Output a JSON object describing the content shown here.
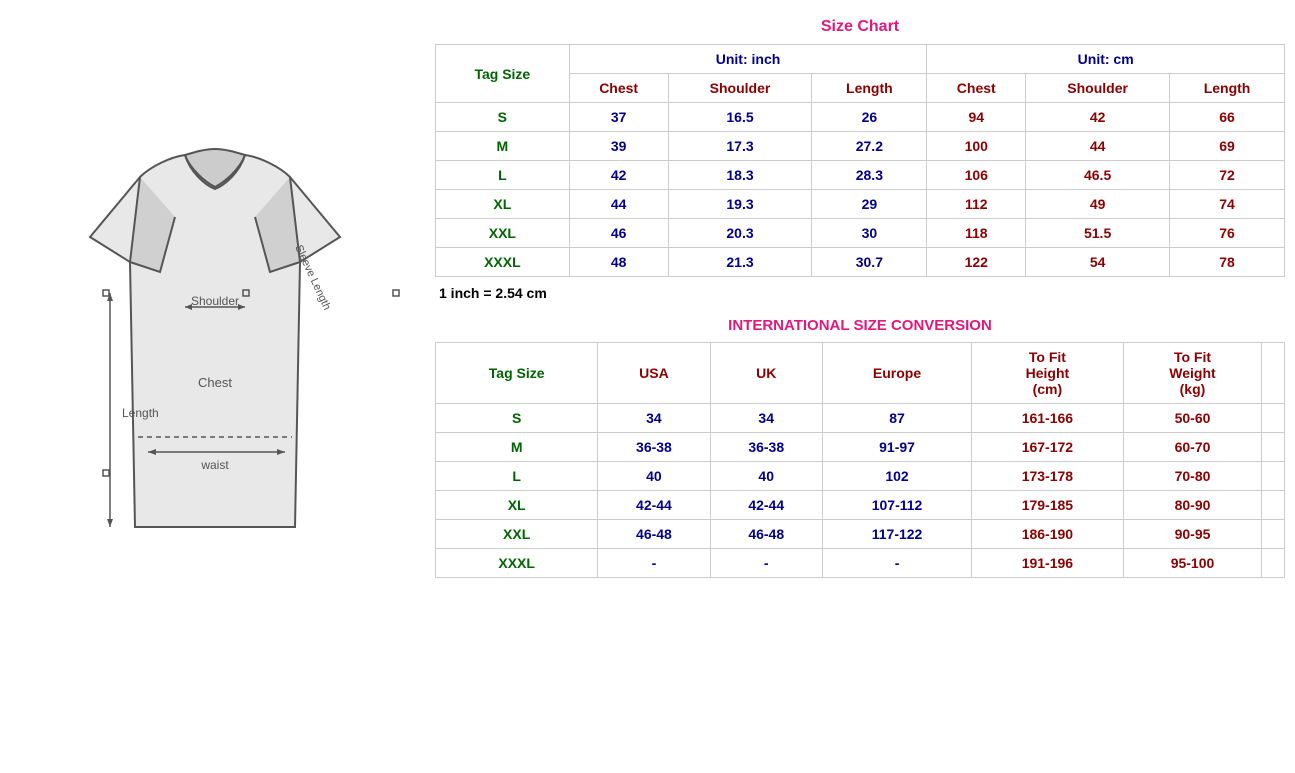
{
  "sizeChart": {
    "title": "Size Chart",
    "unitInch": "Unit: inch",
    "unitCm": "Unit: cm",
    "tagSizeLabel": "Tag Size",
    "headers": {
      "chest": "Chest",
      "shoulder": "Shoulder",
      "length": "Length"
    },
    "rows": [
      {
        "size": "S",
        "chestIn": "37",
        "shoulderIn": "16.5",
        "lengthIn": "26",
        "chestCm": "94",
        "shoulderCm": "42",
        "lengthCm": "66"
      },
      {
        "size": "M",
        "chestIn": "39",
        "shoulderIn": "17.3",
        "lengthIn": "27.2",
        "chestCm": "100",
        "shoulderCm": "44",
        "lengthCm": "69"
      },
      {
        "size": "L",
        "chestIn": "42",
        "shoulderIn": "18.3",
        "lengthIn": "28.3",
        "chestCm": "106",
        "shoulderCm": "46.5",
        "lengthCm": "72"
      },
      {
        "size": "XL",
        "chestIn": "44",
        "shoulderIn": "19.3",
        "lengthIn": "29",
        "chestCm": "112",
        "shoulderCm": "49",
        "lengthCm": "74"
      },
      {
        "size": "XXL",
        "chestIn": "46",
        "shoulderIn": "20.3",
        "lengthIn": "30",
        "chestCm": "118",
        "shoulderCm": "51.5",
        "lengthCm": "76"
      },
      {
        "size": "XXXL",
        "chestIn": "48",
        "shoulderIn": "21.3",
        "lengthIn": "30.7",
        "chestCm": "122",
        "shoulderCm": "54",
        "lengthCm": "78"
      }
    ],
    "conversionNote": "1 inch = 2.54 cm"
  },
  "intlConversion": {
    "title": "INTERNATIONAL SIZE CONVERSION",
    "tagSizeLabel": "Tag Size",
    "headers": {
      "usa": "USA",
      "uk": "UK",
      "europe": "Europe",
      "toFitHeight": "To Fit",
      "heightSub": "Height",
      "heightUnit": "(cm)",
      "toFitWeight": "To Fit",
      "weightSub": "Weight",
      "weightUnit": "(kg)"
    },
    "rows": [
      {
        "size": "S",
        "usa": "34",
        "uk": "34",
        "europe": "87",
        "height": "161-166",
        "weight": "50-60"
      },
      {
        "size": "M",
        "usa": "36-38",
        "uk": "36-38",
        "europe": "91-97",
        "height": "167-172",
        "weight": "60-70"
      },
      {
        "size": "L",
        "usa": "40",
        "uk": "40",
        "europe": "102",
        "height": "173-178",
        "weight": "70-80"
      },
      {
        "size": "XL",
        "usa": "42-44",
        "uk": "42-44",
        "europe": "107-112",
        "height": "179-185",
        "weight": "80-90"
      },
      {
        "size": "XXL",
        "usa": "46-48",
        "uk": "46-48",
        "europe": "117-122",
        "height": "186-190",
        "weight": "90-95"
      },
      {
        "size": "XXXL",
        "usa": "-",
        "uk": "-",
        "europe": "-",
        "height": "191-196",
        "weight": "95-100"
      }
    ]
  },
  "diagram": {
    "shoulderLabel": "Shoulder",
    "sleeveLengthLabel": "Sleeve Length",
    "chestLabel": "Chest",
    "lengthLabel": "Length",
    "waistLabel": "waist"
  }
}
